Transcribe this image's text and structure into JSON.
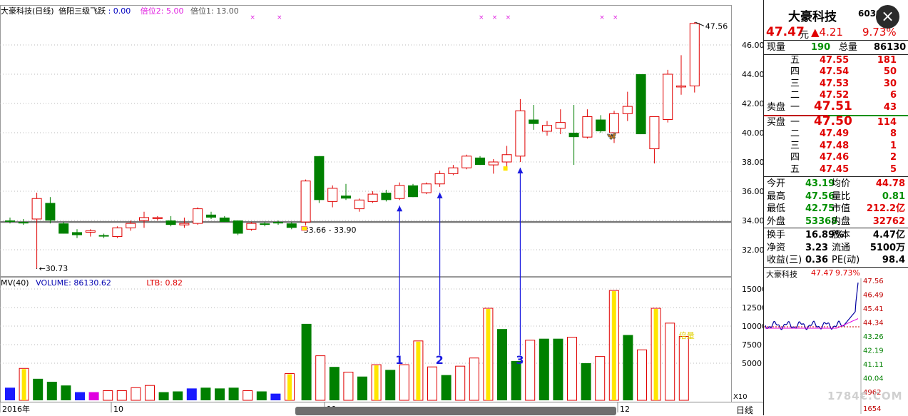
{
  "header": {
    "stock": "大豪科技(日线)",
    "indicator": "倍阳三级飞跃",
    "indicator_value": ": 0.00",
    "level2": "倍位2: 5.00",
    "level1": "倍位1: 13.00"
  },
  "price_axis": {
    "ticks": [
      "46.00",
      "44.00",
      "42.00",
      "40.00",
      "38.00",
      "36.00",
      "34.00",
      "32.00"
    ]
  },
  "price_annotations": {
    "high": "47.56",
    "low": "30.73",
    "range": "33.66 - 33.90"
  },
  "volume_header": {
    "mv": "MV(40)",
    "volume": "VOLUME: 86130.62",
    "ltb": "LTB: 0.82"
  },
  "volume_axis": {
    "ticks": [
      "15000",
      "12500",
      "10000",
      "7500",
      "5000"
    ],
    "multiplier": "X10"
  },
  "volume_annotations": {
    "double": "倍量"
  },
  "markers": [
    "1",
    "2",
    "3"
  ],
  "date_axis": {
    "labels": [
      "2016年",
      "10",
      "11",
      "12"
    ]
  },
  "period_label": "日线",
  "close_icon": "×",
  "watermark": "1784€.COM",
  "panel": {
    "name": "大豪科技",
    "code": "60302",
    "price": "47.47",
    "price_unit": "元",
    "change": "▲4.21",
    "change_pct": "9.73%",
    "current_volume_label": "现量",
    "current_volume": "190",
    "total_volume_label": "总量",
    "total_volume": "86130",
    "asks": [
      {
        "label": "五",
        "price": "47.55",
        "vol": "181"
      },
      {
        "label": "四",
        "price": "47.54",
        "vol": "50"
      },
      {
        "label": "三",
        "price": "47.53",
        "vol": "30"
      },
      {
        "label": "二",
        "price": "47.52",
        "vol": "6"
      },
      {
        "label": "一",
        "price": "47.51",
        "vol": "43",
        "side": "卖盘"
      }
    ],
    "bids": [
      {
        "label": "一",
        "price": "47.50",
        "vol": "114",
        "side": "买盘"
      },
      {
        "label": "二",
        "price": "47.49",
        "vol": "8"
      },
      {
        "label": "三",
        "price": "47.48",
        "vol": "1"
      },
      {
        "label": "四",
        "price": "47.46",
        "vol": "2"
      },
      {
        "label": "五",
        "price": "47.45",
        "vol": "5"
      }
    ],
    "stats1": [
      {
        "l1": "今开",
        "v1": "43.19",
        "l2": "均价",
        "v2": "44.78"
      },
      {
        "l1": "最高",
        "v1": "47.56",
        "l2": "量比",
        "v2": "0.81"
      },
      {
        "l1": "最低",
        "v1": "42.75",
        "l2": "市值",
        "v2": "212.2亿"
      },
      {
        "l1": "外盘",
        "v1": "53368",
        "l2": "内盘",
        "v2": "32762"
      }
    ],
    "stats2": [
      {
        "l1": "换手",
        "v1": "16.89%",
        "l2": "股本",
        "v2": "4.47亿"
      },
      {
        "l1": "净资",
        "v1": "3.23",
        "l2": "流通",
        "v2": "5100万"
      },
      {
        "l1": "收益(三)",
        "v1": "0.36",
        "l2": "PE(动)",
        "v2": "98.4"
      }
    ],
    "mini_chart": {
      "name": "大豪科技",
      "price": "47.47",
      "pct": "9.73%",
      "axis": [
        "47.56",
        "46.49",
        "45.41",
        "44.34",
        "43.26",
        "42.19",
        "41.11",
        "40.04",
        "4962"
      ],
      "bottom": "1654"
    }
  },
  "chart_data": {
    "type": "candlestick",
    "ylim": [
      31,
      47.8
    ],
    "candles": [
      [
        34.0,
        34.2,
        33.8,
        33.9
      ],
      [
        33.9,
        34.1,
        33.7,
        33.8
      ],
      [
        34.1,
        35.9,
        30.73,
        35.5
      ],
      [
        35.2,
        35.6,
        33.8,
        34.0
      ],
      [
        33.8,
        33.9,
        33.1,
        33.1
      ],
      [
        33.2,
        33.4,
        32.8,
        33.0
      ],
      [
        33.2,
        33.4,
        32.9,
        33.3
      ],
      [
        33.0,
        33.1,
        32.8,
        32.9
      ],
      [
        32.9,
        33.6,
        32.8,
        33.5
      ],
      [
        33.5,
        34.0,
        33.3,
        33.8
      ],
      [
        34.0,
        34.6,
        33.5,
        34.2
      ],
      [
        34.2,
        34.3,
        34.0,
        34.2
      ],
      [
        34.0,
        34.3,
        33.6,
        33.7
      ],
      [
        33.7,
        34.2,
        33.5,
        33.8
      ],
      [
        33.8,
        34.9,
        33.7,
        34.8
      ],
      [
        34.4,
        34.6,
        34.1,
        34.2
      ],
      [
        34.2,
        34.3,
        33.9,
        33.9
      ],
      [
        34.0,
        34.0,
        33.0,
        33.1
      ],
      [
        33.4,
        33.9,
        33.3,
        33.8
      ],
      [
        33.8,
        33.9,
        33.6,
        33.7
      ],
      [
        33.9,
        34.0,
        33.7,
        33.8
      ],
      [
        33.8,
        33.9,
        33.4,
        33.5
      ],
      [
        33.9,
        36.8,
        33.66,
        36.7
      ],
      [
        38.4,
        38.4,
        35.2,
        35.4
      ],
      [
        35.3,
        36.4,
        34.9,
        36.2
      ],
      [
        35.7,
        36.5,
        35.4,
        35.5
      ],
      [
        34.8,
        35.5,
        34.6,
        35.4
      ],
      [
        35.3,
        36.0,
        35.2,
        35.8
      ],
      [
        35.9,
        36.1,
        35.3,
        35.4
      ],
      [
        35.5,
        36.6,
        35.4,
        36.4
      ],
      [
        36.4,
        36.5,
        35.6,
        35.6
      ],
      [
        35.9,
        36.6,
        35.8,
        36.5
      ],
      [
        36.5,
        37.4,
        36.3,
        37.2
      ],
      [
        37.2,
        37.8,
        37.1,
        37.6
      ],
      [
        37.6,
        38.5,
        37.5,
        38.4
      ],
      [
        38.3,
        38.4,
        37.8,
        37.8
      ],
      [
        37.8,
        38.2,
        37.2,
        38.0
      ],
      [
        38.0,
        39.1,
        37.6,
        38.5
      ],
      [
        38.4,
        42.3,
        38.0,
        41.5
      ],
      [
        40.9,
        41.9,
        40.2,
        40.6
      ],
      [
        40.1,
        40.8,
        39.8,
        40.5
      ],
      [
        40.3,
        41.6,
        39.9,
        40.7
      ],
      [
        40.0,
        41.9,
        37.8,
        39.7
      ],
      [
        39.7,
        41.6,
        39.6,
        41.1
      ],
      [
        40.9,
        41.2,
        40.0,
        40.1
      ],
      [
        40.0,
        41.5,
        39.3,
        41.3
      ],
      [
        41.3,
        42.8,
        40.8,
        41.8
      ],
      [
        44.0,
        44.0,
        39.9,
        39.9
      ],
      [
        38.9,
        41.1,
        37.9,
        41.1
      ],
      [
        40.9,
        44.3,
        40.7,
        44.0
      ],
      [
        43.2,
        45.3,
        42.6,
        43.2
      ],
      [
        43.2,
        47.56,
        42.75,
        47.47
      ]
    ],
    "volumes": [
      [
        1700,
        "B"
      ],
      [
        4300,
        "U",
        1
      ],
      [
        2900,
        "D"
      ],
      [
        2500,
        "D"
      ],
      [
        2000,
        "D"
      ],
      [
        1100,
        "B"
      ],
      [
        1100,
        "M"
      ],
      [
        1300,
        "U"
      ],
      [
        1300,
        "U"
      ],
      [
        1700,
        "U"
      ],
      [
        2000,
        "U"
      ],
      [
        1100,
        "D"
      ],
      [
        1200,
        "D"
      ],
      [
        1600,
        "B"
      ],
      [
        1700,
        "D"
      ],
      [
        1600,
        "D"
      ],
      [
        1700,
        "D"
      ],
      [
        1300,
        "U"
      ],
      [
        1200,
        "D"
      ],
      [
        900,
        "B"
      ],
      [
        3600,
        "U",
        1
      ],
      [
        10300,
        "D"
      ],
      [
        6000,
        "U"
      ],
      [
        4500,
        "D"
      ],
      [
        3800,
        "U"
      ],
      [
        3200,
        "D"
      ],
      [
        4800,
        "U",
        1
      ],
      [
        4100,
        "D"
      ],
      [
        4800,
        "U"
      ],
      [
        8000,
        "U",
        1
      ],
      [
        4500,
        "U"
      ],
      [
        3400,
        "D"
      ],
      [
        4600,
        "U"
      ],
      [
        5700,
        "U"
      ],
      [
        12400,
        "U",
        1
      ],
      [
        9600,
        "D"
      ],
      [
        5300,
        "D"
      ],
      [
        8100,
        "U"
      ],
      [
        8300,
        "D"
      ],
      [
        8300,
        "D"
      ],
      [
        8500,
        "U"
      ],
      [
        5000,
        "D"
      ],
      [
        5900,
        "U"
      ],
      [
        14800,
        "U",
        1
      ],
      [
        8800,
        "D"
      ],
      [
        6800,
        "U"
      ],
      [
        12400,
        "U",
        1
      ],
      [
        10400,
        "U"
      ],
      [
        8600,
        "U"
      ]
    ]
  }
}
